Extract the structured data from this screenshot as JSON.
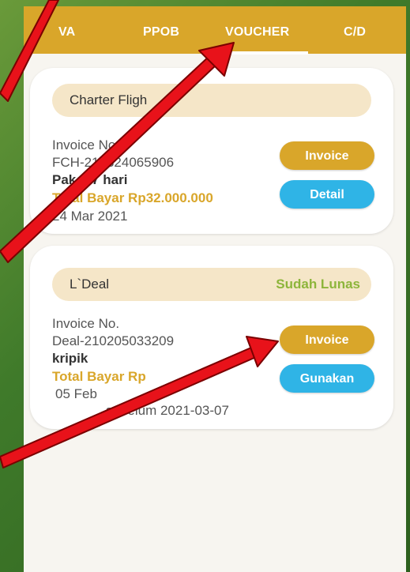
{
  "tabs": [
    {
      "label": "VA"
    },
    {
      "label": "PPOB"
    },
    {
      "label": "VOUCHER"
    },
    {
      "label": "C/D"
    }
  ],
  "cards": [
    {
      "title": "Charter Fligh",
      "invoice_label": "Invoice No.",
      "invoice_no": "FCH-210324065906",
      "package": "Paket 7 hari",
      "total": "Total Bayar Rp32.000.000",
      "date": "24 Mar 2021",
      "buttons": {
        "invoice": "Invoice",
        "detail": "Detail"
      }
    },
    {
      "title": "L`Deal",
      "status": "Sudah Lunas",
      "invoice_label": "Invoice No.",
      "invoice_no": "Deal-210205033209",
      "package": "kripik",
      "total": "Total Bayar Rp",
      "date": "05 Feb",
      "valid_until": "sebelum 2021-03-07",
      "buttons": {
        "invoice": "Invoice",
        "use": "Gunakan"
      }
    }
  ],
  "colors": {
    "tab_bar": "#d9a62a",
    "gold": "#d9a62a",
    "blue": "#2fb4e6",
    "status_green": "#8db53b",
    "arrow": "#e8121a"
  }
}
